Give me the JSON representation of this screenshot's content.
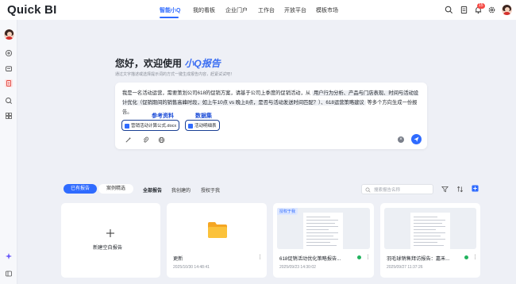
{
  "app": {
    "logo": "Quick BI"
  },
  "nav": [
    {
      "label": "智能小Q",
      "active": true
    },
    {
      "label": "我的看板",
      "active": false
    },
    {
      "label": "企业门户",
      "active": false
    },
    {
      "label": "工作台",
      "active": false
    },
    {
      "label": "开放平台",
      "active": false
    },
    {
      "label": "模板市场",
      "active": false
    }
  ],
  "topbar": {
    "notification_count": "15"
  },
  "hero": {
    "title_prefix": "您好，欢迎使用",
    "title_accent": "小Q报告",
    "subtitle": "通过文字描述或选择提示词的方式一键生成报告内容，赶紧试试吧！"
  },
  "prompt": {
    "text_1": "我是一名活动运营，需要策划公司618的促销方案，请基于公司上季度的促销活动，从",
    "tag_1": "用户行为分析、产品与门店表现、时间与活动设计优化（促销期间的销售高峰时段，如上午10点 vs 晚上8点，是否与活动发送时间匹配？）、618运营策略建议",
    "text_2": "等多个方向生成一份报告。"
  },
  "annotations": {
    "reference": "参考资料",
    "dataset": "数据集"
  },
  "attachments": {
    "file": "营销活动计算公式.docx",
    "dataset": "活动明细表"
  },
  "report_tabs": {
    "mine": "已有报告",
    "cases": "案例精选"
  },
  "filters": {
    "all": "全部报告",
    "created": "我创建的",
    "authorized": "授权于我"
  },
  "search": {
    "placeholder": "搜索报告名称"
  },
  "cards": [
    {
      "title": "新建空白报告"
    },
    {
      "title": "更新",
      "date": "2025/10/30 14:48:41"
    },
    {
      "title": "618促销活动优化策略报告...",
      "date": "2025/09/23 14:30:02"
    },
    {
      "title": "羽毛球销售拜访报告：嘉禾...",
      "date": "2025/09/27 11:37:26",
      "tag": "授权于我"
    }
  ],
  "card3_tag": "授权于我",
  "colors": {
    "accent": "#2f6bff",
    "annotation": "#1f4fd8",
    "badge": "#f54a45"
  }
}
